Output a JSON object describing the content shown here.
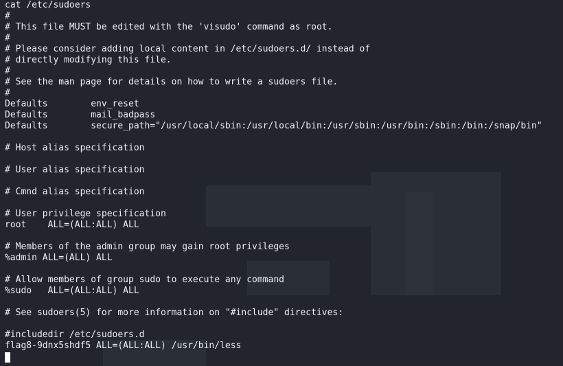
{
  "terminal": {
    "lines": [
      "cat /etc/sudoers",
      "#",
      "# This file MUST be edited with the 'visudo' command as root.",
      "#",
      "# Please consider adding local content in /etc/sudoers.d/ instead of",
      "# directly modifying this file.",
      "#",
      "# See the man page for details on how to write a sudoers file.",
      "#",
      "Defaults        env_reset",
      "Defaults        mail_badpass",
      "Defaults        secure_path=\"/usr/local/sbin:/usr/local/bin:/usr/sbin:/usr/bin:/sbin:/bin:/snap/bin\"",
      "",
      "# Host alias specification",
      "",
      "# User alias specification",
      "",
      "# Cmnd alias specification",
      "",
      "# User privilege specification",
      "root    ALL=(ALL:ALL) ALL",
      "",
      "# Members of the admin group may gain root privileges",
      "%admin ALL=(ALL) ALL",
      "",
      "# Allow members of group sudo to execute any command",
      "%sudo   ALL=(ALL:ALL) ALL",
      "",
      "# See sudoers(5) for more information on \"#include\" directives:",
      "",
      "#includedir /etc/sudoers.d",
      "flag8-9dnx5shdf5 ALL=(ALL:ALL) /usr/bin/less"
    ],
    "cursor_line": ""
  }
}
